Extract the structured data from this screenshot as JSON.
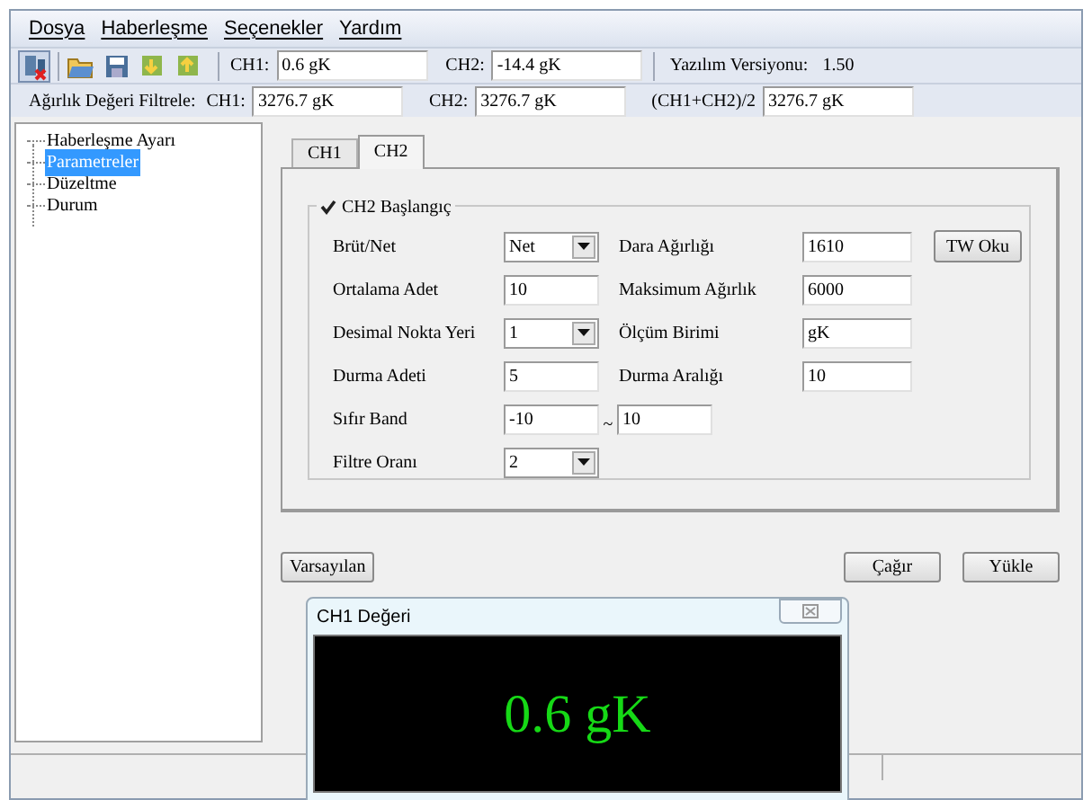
{
  "menu": [
    "Dosya",
    "Haberleşme",
    "Seçenekler",
    "Yardım"
  ],
  "toolbar": {
    "ch1_label": "CH1:",
    "ch1_value": "0.6 gK",
    "ch2_label": "CH2:",
    "ch2_value": "-14.4 gK",
    "version_label": "Yazılım Versiyonu:",
    "version": "1.50"
  },
  "filter": {
    "label": "Ağırlık Değeri Filtrele:",
    "items": [
      {
        "label": "CH1:",
        "value": "3276.7 gK"
      },
      {
        "label": "CH2:",
        "value": "3276.7 gK"
      },
      {
        "label": "(CH1+CH2)/2",
        "value": "3276.7 gK"
      }
    ]
  },
  "tree": [
    {
      "label": "Haberleşme Ayarı",
      "selected": false
    },
    {
      "label": "Parametreler",
      "selected": true
    },
    {
      "label": "Düzeltme",
      "selected": false
    },
    {
      "label": "Durum",
      "selected": false
    }
  ],
  "tabs": [
    {
      "label": "CH1",
      "selected": false
    },
    {
      "label": "CH2",
      "selected": true
    }
  ],
  "group": {
    "title": "CH2 Başlangıç",
    "checked": true
  },
  "rows": [
    {
      "left": {
        "label": "Brüt/Net",
        "kind": "dropdown",
        "value": "Net"
      },
      "right": {
        "label": "Dara Ağırlığı",
        "value": "1610"
      },
      "button": "TW Oku"
    },
    {
      "left": {
        "label": "Ortalama Adet",
        "kind": "text",
        "value": "10"
      },
      "right": {
        "label": "Maksimum Ağırlık",
        "value": "6000"
      }
    },
    {
      "left": {
        "label": "Desimal Nokta Yeri",
        "kind": "dropdown",
        "value": "1"
      },
      "right": {
        "label": "Ölçüm Birimi",
        "value": "gK"
      }
    },
    {
      "left": {
        "label": "Durma Adeti",
        "kind": "text",
        "value": "5"
      },
      "right": {
        "label": "Durma Aralığı",
        "value": "10"
      }
    },
    {
      "left": {
        "label": "Sıfır Band",
        "kind": "range",
        "value": "-10",
        "separator": "~",
        "value2": "10"
      }
    },
    {
      "left": {
        "label": "Filtre Oranı",
        "kind": "dropdown",
        "value": "2"
      }
    }
  ],
  "buttons": {
    "left": "Varsayılan",
    "right": [
      "Çağır",
      "Yükle"
    ]
  },
  "popup": {
    "title": "CH1 Değeri",
    "value": "0.6 gK"
  }
}
